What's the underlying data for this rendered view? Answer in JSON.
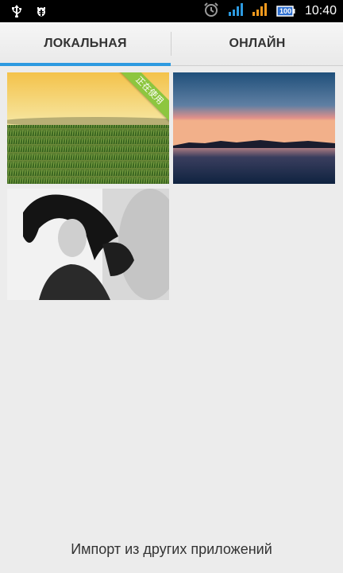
{
  "status_bar": {
    "time": "10:40",
    "battery_level": "100",
    "icons": [
      "usb-icon",
      "android-debug-icon",
      "alarm-clock-icon",
      "signal-blue-icon",
      "signal-orange-icon",
      "battery-icon"
    ]
  },
  "tabs": [
    {
      "label": "ЛОКАЛЬНАЯ",
      "selected": true
    },
    {
      "label": "ОНЛАЙН",
      "selected": false
    }
  ],
  "wallpapers": [
    {
      "name": "wheat-field-sunset",
      "badge": "正在使用"
    },
    {
      "name": "lake-twilight"
    },
    {
      "name": "woman-black-white"
    }
  ],
  "footer": {
    "import_label": "Импорт из других приложений"
  },
  "colors": {
    "accent": "#2d9ae0",
    "badge": "#8dc63f",
    "background": "#ececec"
  }
}
